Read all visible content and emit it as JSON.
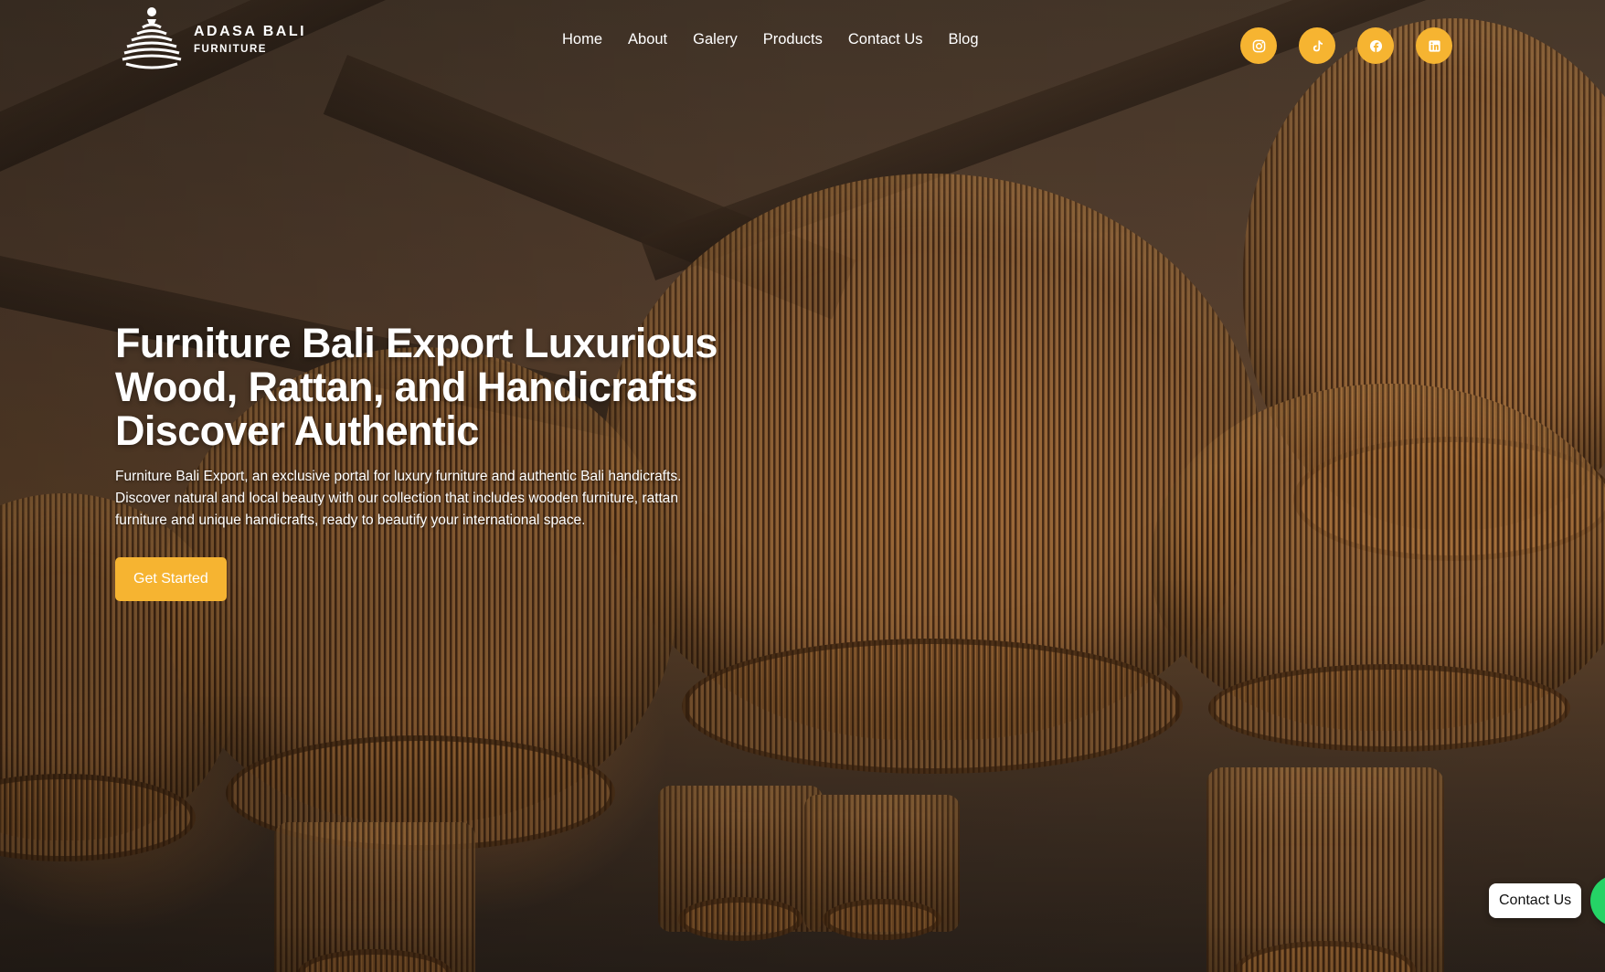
{
  "brand": {
    "name": "ADASA BALI",
    "tagline": "FURNITURE"
  },
  "nav": {
    "items": [
      {
        "label": "Home"
      },
      {
        "label": "About"
      },
      {
        "label": "Galery"
      },
      {
        "label": "Products"
      },
      {
        "label": "Contact Us"
      },
      {
        "label": "Blog"
      }
    ]
  },
  "social": {
    "accent_color": "#f6b431",
    "icons": [
      "instagram-icon",
      "tiktok-icon",
      "facebook-icon",
      "linkedin-icon"
    ]
  },
  "hero": {
    "title": "Furniture Bali Export Luxurious Wood, Rattan, and Handicrafts Discover Authentic",
    "description": "Furniture Bali Export, an exclusive portal for luxury furniture and authentic Bali handicrafts. Discover natural and local beauty with our collection that includes wooden furniture, rattan furniture and unique handicrafts, ready to beautify your international space.",
    "cta_label": "Get Started"
  },
  "floating": {
    "contact_label": "Contact Us",
    "whatsapp_color": "#25d366"
  }
}
